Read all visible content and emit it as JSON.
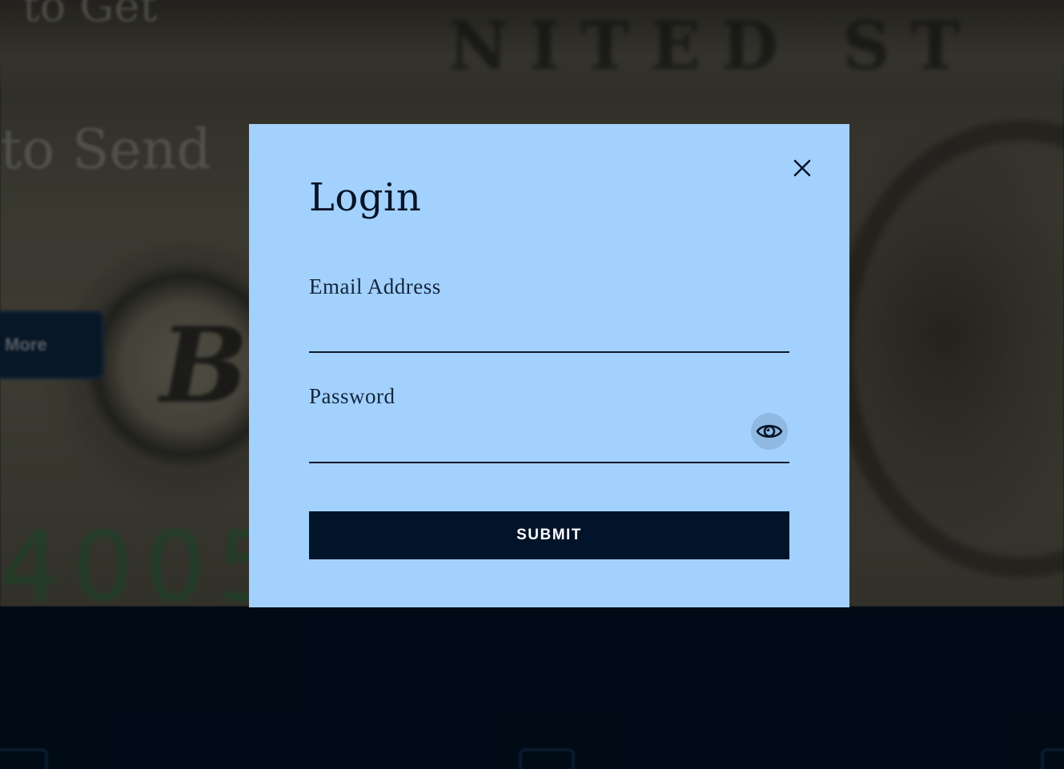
{
  "modal": {
    "title": "Login",
    "email_label": "Email Address",
    "email_value": "",
    "password_label": "Password",
    "password_value": "",
    "submit_label": "SUBMIT",
    "close_icon": "close-icon",
    "toggle_icon": "eye-icon"
  },
  "background": {
    "heading_line_1": "to Get",
    "heading_line_2": "to Send",
    "button_label": "More",
    "seal_letter": "B",
    "note_number": "4005",
    "note_banner": "NITED ST"
  },
  "colors": {
    "modal_bg": "#a3d1fe",
    "submit_bg": "#011429",
    "text_dark": "#071426",
    "footer_bg": "#011429",
    "overlay": "rgba(0,0,0,0.45)"
  }
}
